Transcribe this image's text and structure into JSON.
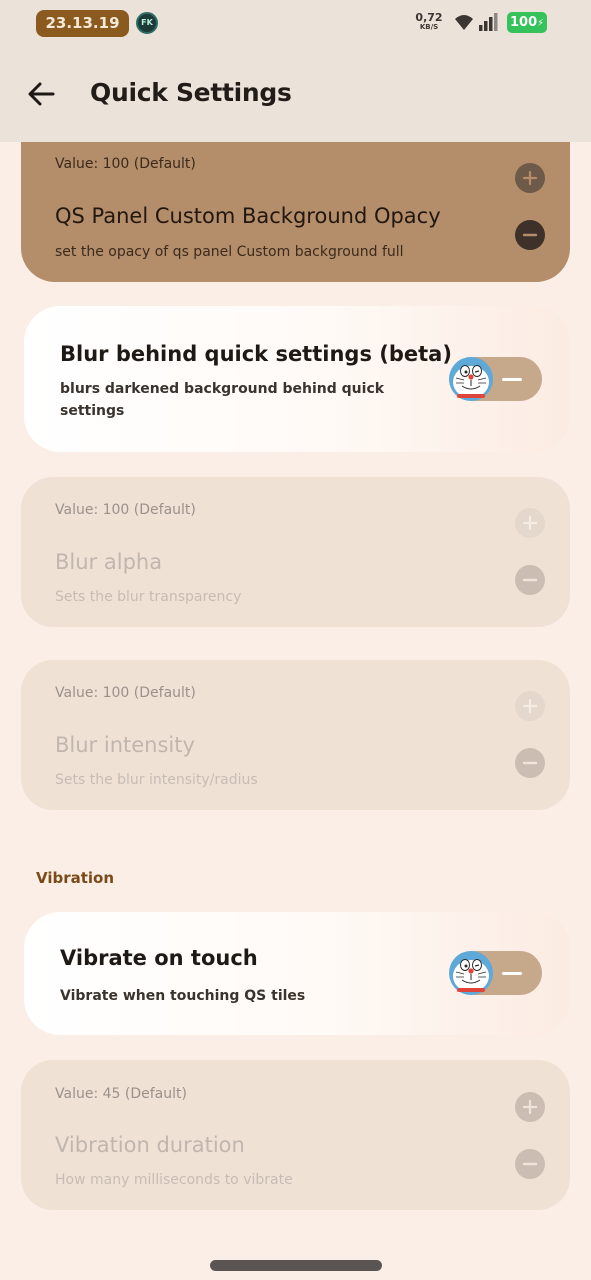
{
  "status_bar": {
    "time": "23.13.19",
    "app_badge": "FK",
    "net_speed": "0,72",
    "net_unit": "KB/S",
    "battery": "100"
  },
  "header": {
    "title": "Quick Settings"
  },
  "cards": {
    "qs_opacity": {
      "value": "Value: 100 (Default)",
      "title": "QS Panel Custom Background Opacy",
      "subtitle": "set the opacy of qs panel Custom background full"
    },
    "blur_behind": {
      "title": "Blur behind quick settings (beta)",
      "subtitle": "blurs darkened background behind quick settings"
    },
    "blur_alpha": {
      "value": "Value: 100 (Default)",
      "title": "Blur alpha",
      "subtitle": "Sets the blur transparency"
    },
    "blur_intensity": {
      "value": "Value: 100 (Default)",
      "title": "Blur intensity",
      "subtitle": "Sets the blur intensity/radius"
    },
    "vibrate_touch": {
      "title": "Vibrate on touch",
      "subtitle": "Vibrate when touching QS tiles"
    },
    "vibration_duration": {
      "value": "Value: 45 (Default)",
      "title": "Vibration duration",
      "subtitle": "How many milliseconds to vibrate"
    }
  },
  "sections": {
    "vibration": "Vibration"
  },
  "colors": {
    "accent": "#b48e6a",
    "background": "#faeee6",
    "card": "#efe2d5",
    "section_label": "#7a4a18",
    "battery": "#35c25a"
  },
  "icons": {
    "back": "arrow-left",
    "increase": "plus",
    "decrease": "minus",
    "toggle_knob": "cat-face"
  }
}
